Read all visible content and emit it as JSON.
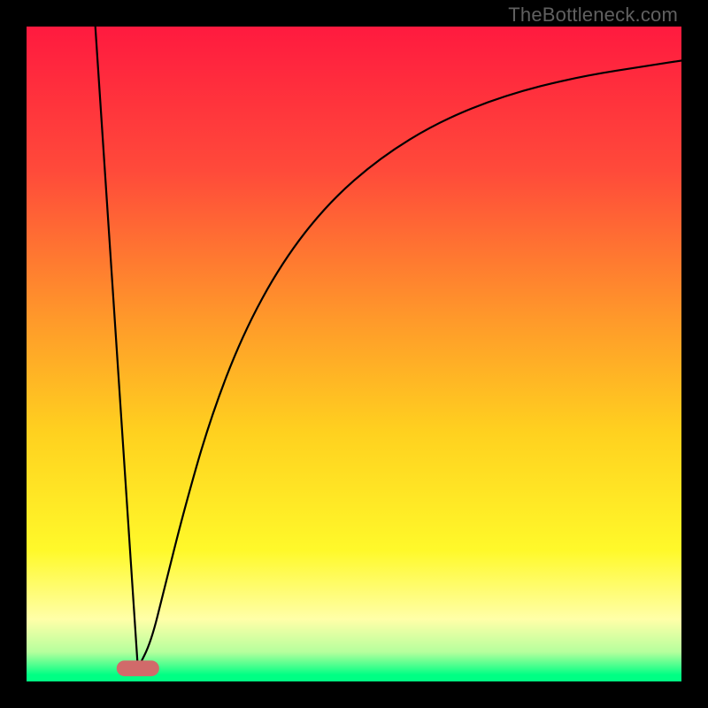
{
  "watermark": "TheBottleneck.com",
  "chart_data": {
    "type": "line",
    "title": "",
    "xlabel": "",
    "ylabel": "",
    "xlim": [
      0,
      100
    ],
    "ylim": [
      0,
      100
    ],
    "background_gradient": {
      "stops": [
        {
          "offset": 0.0,
          "color": "#ff1a3f"
        },
        {
          "offset": 0.22,
          "color": "#ff4a3a"
        },
        {
          "offset": 0.45,
          "color": "#ff9a2a"
        },
        {
          "offset": 0.62,
          "color": "#ffd11f"
        },
        {
          "offset": 0.8,
          "color": "#fff92a"
        },
        {
          "offset": 0.905,
          "color": "#ffffa8"
        },
        {
          "offset": 0.955,
          "color": "#b6ff9d"
        },
        {
          "offset": 0.99,
          "color": "#00ff84"
        }
      ]
    },
    "notch_x": 17,
    "marker": {
      "x": 17,
      "y": 2,
      "width": 6.5,
      "height": 2.4,
      "color": "#d16a6a"
    },
    "series": [
      {
        "name": "left-line",
        "x": [
          10.5,
          17
        ],
        "y": [
          100,
          2.0
        ]
      },
      {
        "name": "right-curve",
        "x": [
          17,
          19,
          21,
          24,
          28,
          33,
          39,
          46,
          54,
          63,
          73,
          84,
          96,
          100
        ],
        "y": [
          2.0,
          6,
          14,
          26,
          40,
          53,
          64,
          73,
          80,
          85.5,
          89.5,
          92.3,
          94.2,
          94.8
        ]
      }
    ]
  }
}
